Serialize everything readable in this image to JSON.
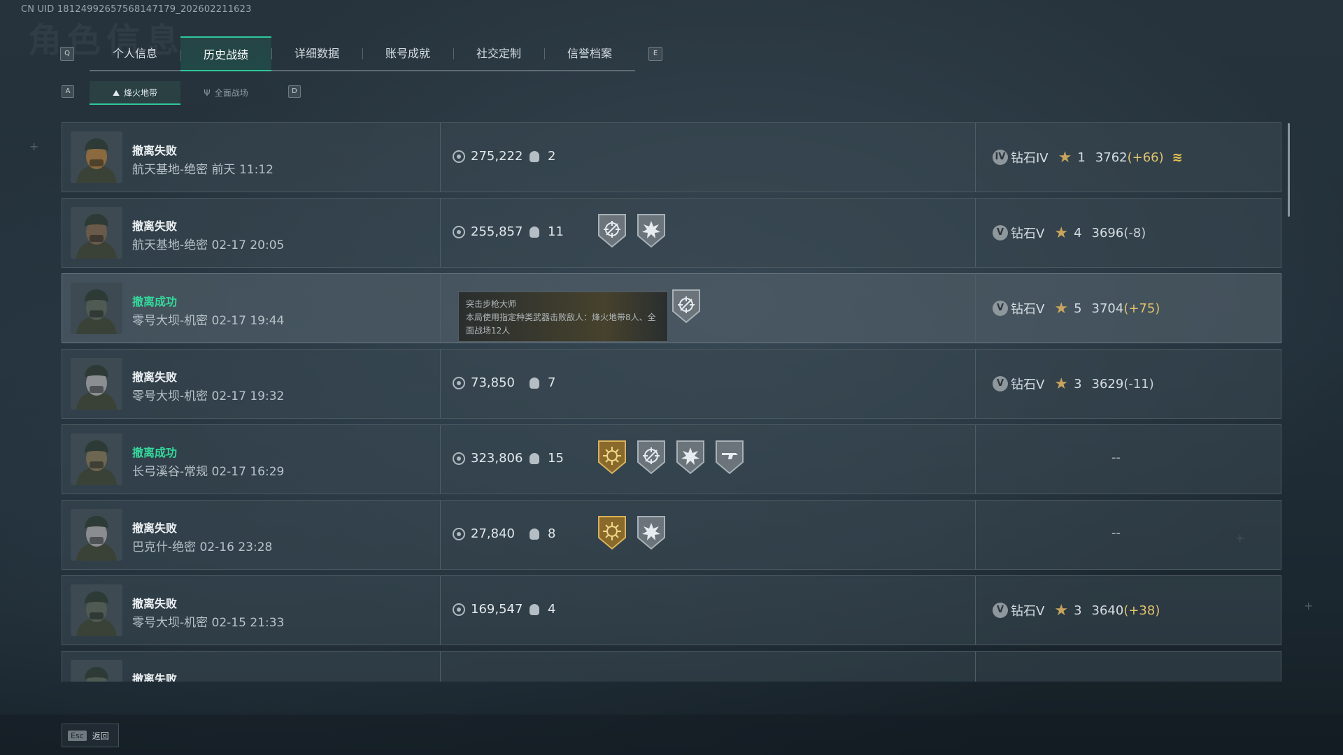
{
  "uid": "CN UID 18124992657568147179_202602211623",
  "watermark": "角色信息",
  "keys": {
    "q": "Q",
    "e": "E",
    "a": "A",
    "d": "D"
  },
  "tabs": [
    "个人信息",
    "历史战绩",
    "详细数据",
    "账号成就",
    "社交定制",
    "信誉档案"
  ],
  "active_tab": "历史战绩",
  "subtabs": [
    "烽火地带",
    "全面战场"
  ],
  "active_subtab": "烽火地带",
  "records": [
    {
      "status": "撤离失败",
      "success": false,
      "detail": "航天基地-绝密 前天 11:12",
      "money": "275,222",
      "kills": "2",
      "badges": [],
      "rank_icon": "IV",
      "rank": "钻石IV",
      "stars": "1",
      "score": "3762",
      "delta": "(+66)",
      "delta_positive": true,
      "promo": true
    },
    {
      "status": "撤离失败",
      "success": false,
      "detail": "航天基地-绝密 02-17 20:05",
      "money": "255,857",
      "kills": "11",
      "badges": [
        "scope-badge-icon",
        "burst-badge-icon"
      ],
      "rank_icon": "V",
      "rank": "钻石V",
      "stars": "4",
      "score": "3696",
      "delta": "(-8)",
      "delta_positive": false,
      "promo": false
    },
    {
      "status": "撤离成功",
      "success": true,
      "detail": "零号大坝-机密 02-17 19:44",
      "money": "",
      "kills": "",
      "badges": [
        "scope-badge-icon"
      ],
      "rank_icon": "V",
      "rank": "钻石V",
      "stars": "5",
      "score": "3704",
      "delta": "(+75)",
      "delta_positive": true,
      "promo": false
    },
    {
      "status": "撤离失败",
      "success": false,
      "detail": "零号大坝-机密 02-17 19:32",
      "money": "73,850",
      "kills": "7",
      "badges": [],
      "rank_icon": "V",
      "rank": "钻石V",
      "stars": "3",
      "score": "3629",
      "delta": "(-11)",
      "delta_positive": false,
      "promo": false
    },
    {
      "status": "撤离成功",
      "success": true,
      "detail": "长弓溪谷-常规 02-17 16:29",
      "money": "323,806",
      "kills": "15",
      "badges": [
        "sun-badge-icon",
        "scope-badge-icon",
        "burst-badge-icon",
        "gun-badge-icon"
      ],
      "rank_icon": "",
      "rank": "",
      "stars": "",
      "score": "",
      "delta": "",
      "delta_positive": false,
      "promo": false,
      "rank_empty": "--"
    },
    {
      "status": "撤离失败",
      "success": false,
      "detail": "巴克什-绝密 02-16 23:28",
      "money": "27,840",
      "kills": "8",
      "badges": [
        "sun-badge-icon",
        "burst-badge-icon"
      ],
      "rank_icon": "",
      "rank": "",
      "stars": "",
      "score": "",
      "delta": "",
      "delta_positive": false,
      "promo": false,
      "rank_empty": "--"
    },
    {
      "status": "撤离失败",
      "success": false,
      "detail": "零号大坝-机密 02-15 21:33",
      "money": "169,547",
      "kills": "4",
      "badges": [],
      "rank_icon": "V",
      "rank": "钻石V",
      "stars": "3",
      "score": "3640",
      "delta": "(+38)",
      "delta_positive": true,
      "promo": false
    },
    {
      "status": "撤离失败",
      "success": false,
      "detail": "",
      "money": "",
      "kills": "",
      "badges": [],
      "rank_icon": "",
      "rank": "",
      "stars": "",
      "score": "",
      "delta": "",
      "delta_positive": false,
      "promo": false
    }
  ],
  "tooltip": {
    "title": "突击步枪大师",
    "text": "本局使用指定种类武器击败敌人：烽火地带8人、全面战场12人"
  },
  "footer": {
    "key": "Esc",
    "label": "返回"
  },
  "colors": {
    "accent": "#2fc79a",
    "success": "#33d99b",
    "gold": "#e2c36b"
  }
}
